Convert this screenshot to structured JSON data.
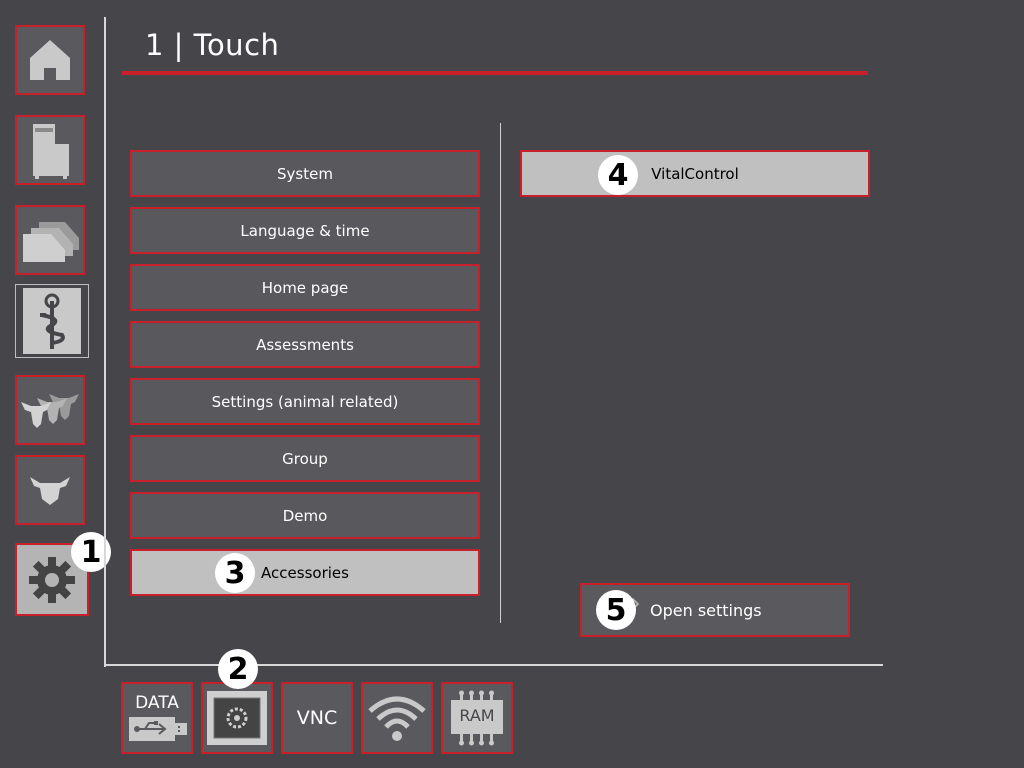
{
  "header": {
    "title": "1 | Touch"
  },
  "nav": {
    "items": [
      {
        "name": "home",
        "icon": "home-icon"
      },
      {
        "name": "feeder",
        "icon": "feeder-icon"
      },
      {
        "name": "pens",
        "icon": "stacked-pens-icon"
      },
      {
        "name": "health",
        "icon": "health-caduceus-icon"
      },
      {
        "name": "herd",
        "icon": "herd-icon"
      },
      {
        "name": "animal",
        "icon": "animal-head-icon"
      },
      {
        "name": "settings",
        "icon": "gear-icon"
      }
    ],
    "active": "settings"
  },
  "menu": {
    "items": [
      {
        "label": "System"
      },
      {
        "label": "Language & time"
      },
      {
        "label": "Home page"
      },
      {
        "label": "Assessments"
      },
      {
        "label": "Settings (animal related)"
      },
      {
        "label": "Group"
      },
      {
        "label": "Demo"
      },
      {
        "label": "Accessories"
      }
    ],
    "active_label": "Accessories"
  },
  "accessories": {
    "items": [
      {
        "label": "VitalControl"
      }
    ]
  },
  "actions": {
    "open_settings": "Open settings"
  },
  "bottom_bar": {
    "data_label": "DATA",
    "vnc_label": "VNC",
    "ram_label": "RAM"
  },
  "badges": {
    "b1": "1",
    "b2": "2",
    "b3": "3",
    "b4": "4",
    "b5": "5"
  },
  "colors": {
    "accent": "#c8202a",
    "background": "#46464a",
    "button": "#59595d",
    "active": "#c0c0c0"
  }
}
